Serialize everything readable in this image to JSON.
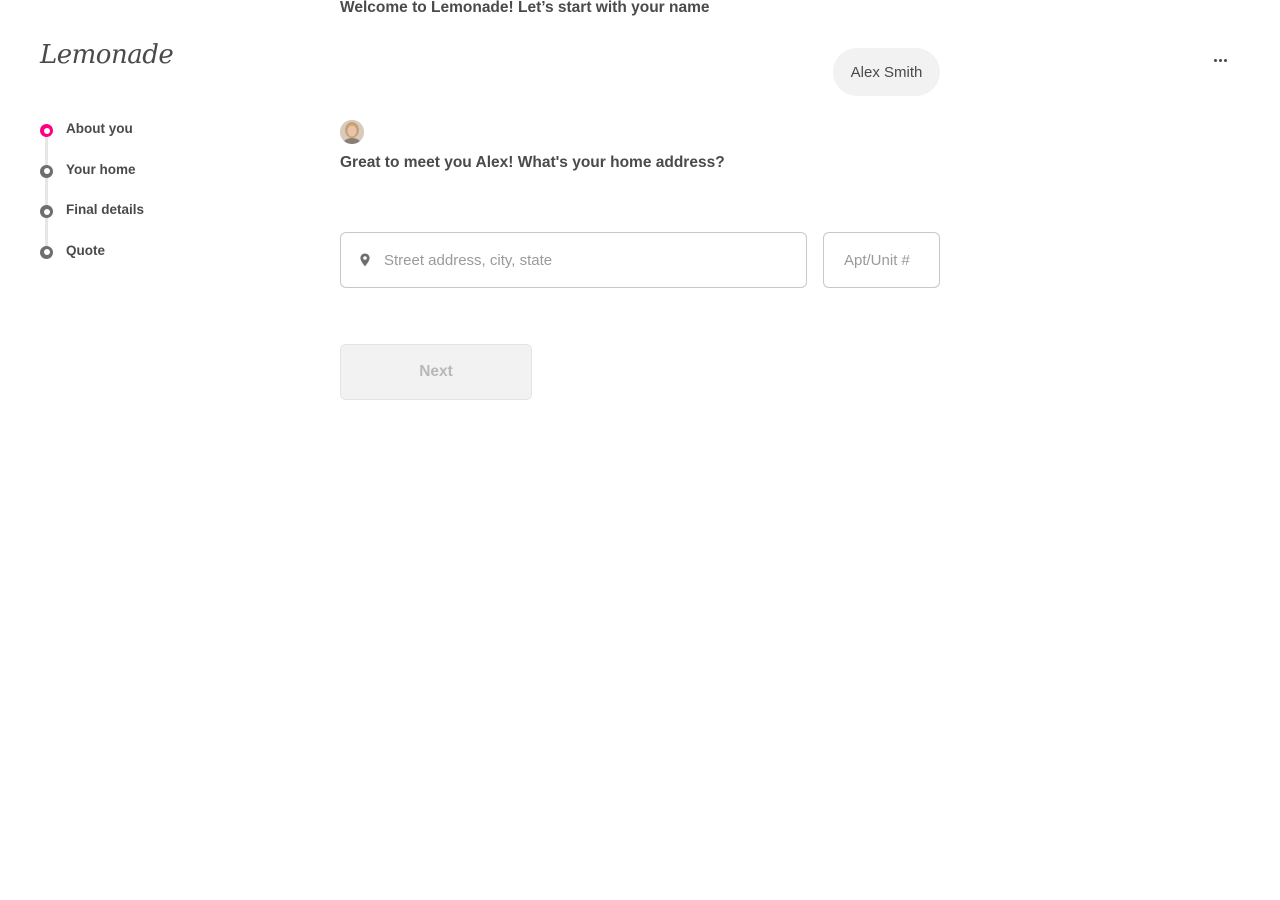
{
  "brand": {
    "logo_text": "Lemonade",
    "accent_color": "#ff0083"
  },
  "menu": {
    "icon": "more-horizontal-icon"
  },
  "steps": [
    {
      "label": "About you",
      "active": true
    },
    {
      "label": "Your home",
      "active": false
    },
    {
      "label": "Final details",
      "active": false
    },
    {
      "label": "Quote",
      "active": false
    }
  ],
  "chat": {
    "question_1": "Welcome to Lemonade! Let’s start with your name",
    "answer_1": "Alex Smith",
    "question_2": "Great to meet you Alex! What's your home address?"
  },
  "form": {
    "address_placeholder": "Street address, city, state",
    "address_value": "",
    "apt_placeholder": "Apt/Unit #",
    "apt_value": "",
    "next_label": "Next",
    "next_enabled": false
  }
}
